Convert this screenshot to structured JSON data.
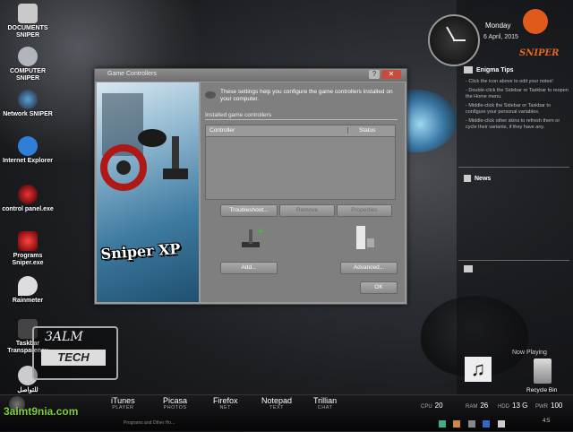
{
  "desktop_icons": [
    {
      "label": "DOCUMENTS SNIPER",
      "icon": "documents-icon"
    },
    {
      "label": "COMPUTER SNIPER",
      "icon": "computer-icon"
    },
    {
      "label": "Network SNIPER",
      "icon": "network-icon"
    },
    {
      "label": "Internet Explorer",
      "icon": "internet-explorer-icon"
    },
    {
      "label": "control panel.exe",
      "icon": "control-panel-icon"
    },
    {
      "label": "Programs Sniper.exe",
      "icon": "programs-icon"
    },
    {
      "label": "Rainmeter",
      "icon": "rainmeter-icon"
    },
    {
      "label": "Taskbar Transparency",
      "icon": "taskbar-icon"
    },
    {
      "label": "للتواصل",
      "icon": "contact-icon"
    }
  ],
  "dialog": {
    "title": "Game Controllers",
    "intro": "These settings help you configure the game controllers installed on your computer.",
    "group_label": "Installed game controllers",
    "columns": [
      "Controller",
      "Status"
    ],
    "buttons": {
      "troubleshoot": "Troubleshoot...",
      "remove": "Remove",
      "properties": "Properties",
      "add": "Add...",
      "advanced": "Advanced...",
      "ok": "OK"
    },
    "brand": "Sniper XP"
  },
  "clock": {
    "day": "Monday",
    "date": "6 April, 2015"
  },
  "sidebar": {
    "logo": "SNIPER",
    "enigma_title": "Enigma Tips",
    "tips": [
      "- Click the icon above to edit your notes!",
      "- Double-click the Sidebar or Taskbar to reopen the Home menu.",
      "- Middle-click the Sidebar or Taskbar to configure your personal variables.",
      "- Middle-click other skins to refresh them or cycle their variants, if they have any."
    ],
    "news_title": "News",
    "now_playing": "Now Playing",
    "recycle_bin": "Recycle Bin"
  },
  "calmtech": {
    "line1": "3ALM",
    "line2": "TECH"
  },
  "taskbar": {
    "apps": [
      {
        "name": "iTunes",
        "sub": "PLAYER"
      },
      {
        "name": "Picasa",
        "sub": "PHOTOS"
      },
      {
        "name": "Firefox",
        "sub": "NET"
      },
      {
        "name": "Notepad",
        "sub": "TEXT"
      },
      {
        "name": "Trillian",
        "sub": "CHAT"
      }
    ],
    "subtext": "Programs and Other Ho...",
    "stats": [
      {
        "label": "CPU",
        "value": "20"
      },
      {
        "label": "RAM",
        "value": "26"
      },
      {
        "label": "HDD",
        "value": "13 G"
      },
      {
        "label": "PWR",
        "value": "100"
      }
    ],
    "time": "4:5",
    "watermark": "3almt9nia.com"
  }
}
